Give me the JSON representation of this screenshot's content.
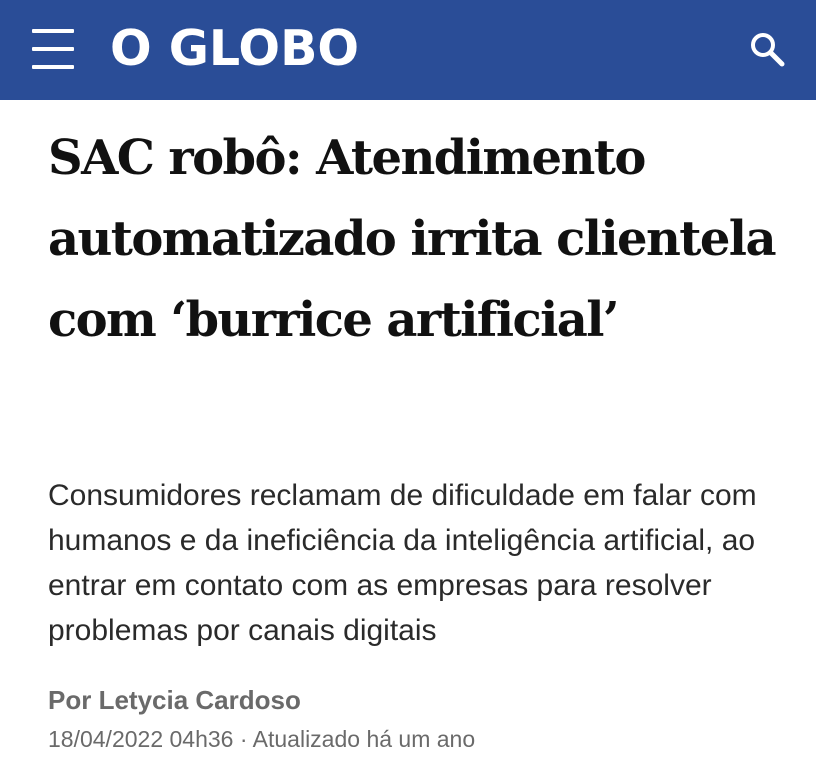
{
  "header": {
    "logo_text": "O GLOBO",
    "background_color": "#2a4d97",
    "menu_icon": "hamburger-menu-icon",
    "search_icon": "search-icon"
  },
  "article": {
    "headline": "SAC robô: Atendimento automatizado irrita clientela com ‘burrice artificial’",
    "subtitle": "Consumidores reclamam de dificuldade em falar com humanos e da ineficiência da inteligência artificial, ao entrar em contato com as empresas para resolver problemas por canais digitais",
    "byline": "Por Letycia Cardoso",
    "published": "18/04/2022 04h36",
    "separator": " · ",
    "updated": "Atualizado há um ano"
  }
}
